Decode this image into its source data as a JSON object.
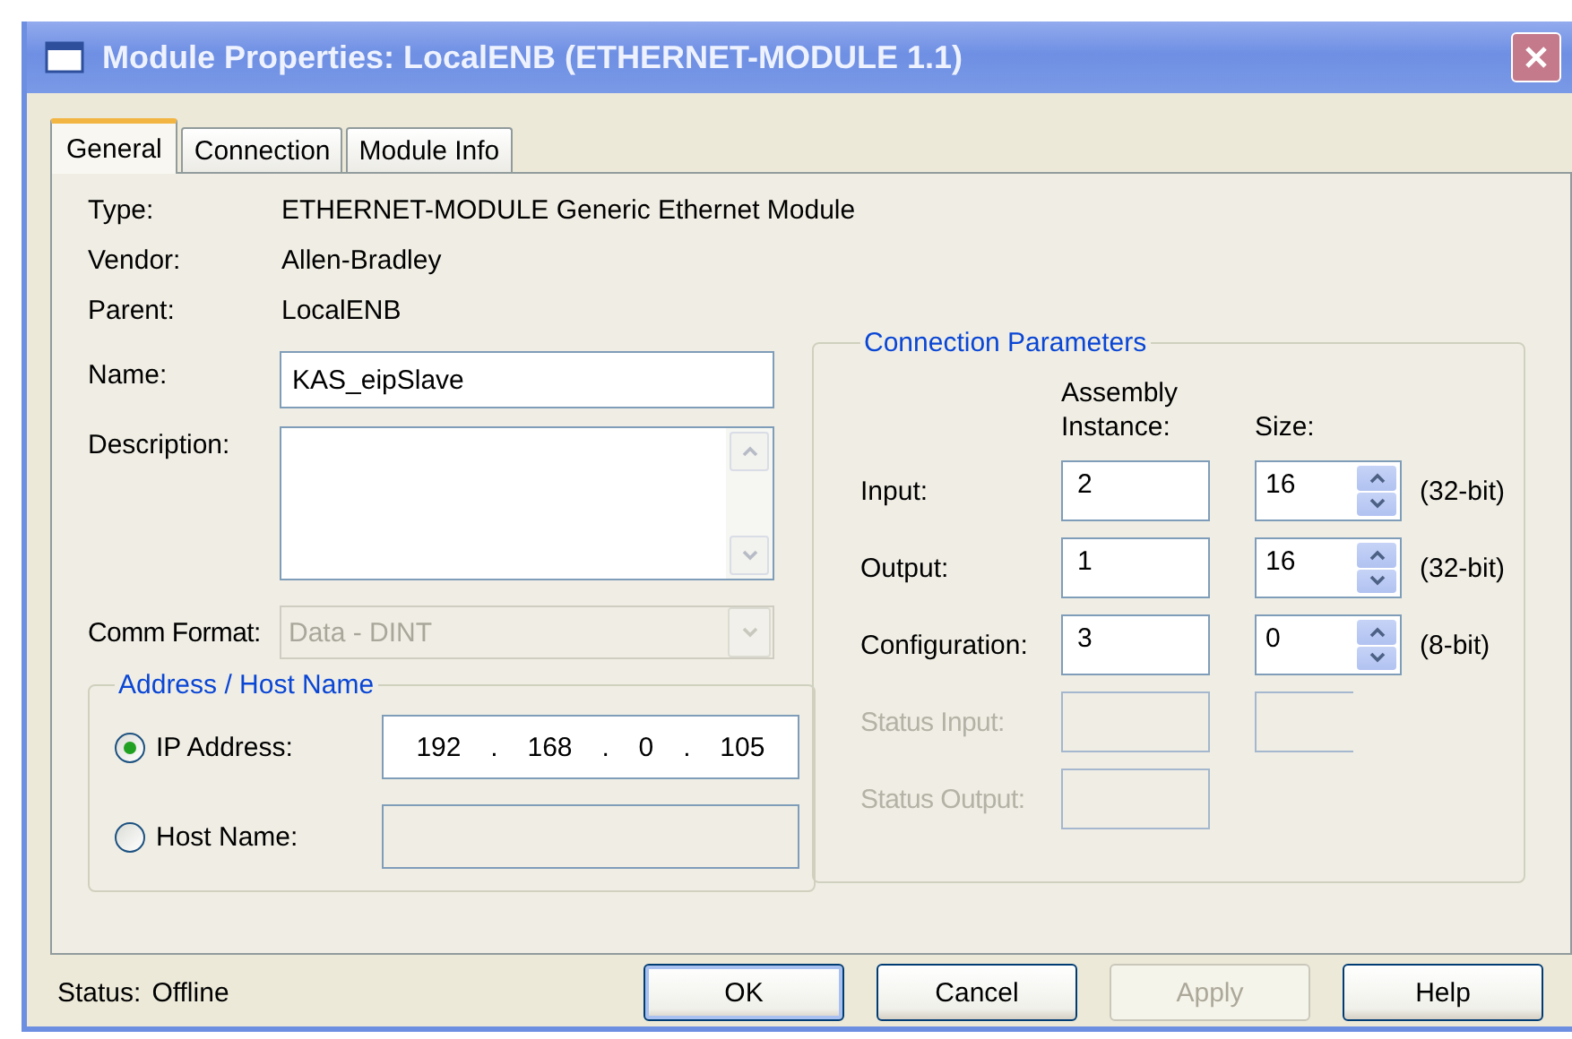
{
  "window": {
    "title": "Module Properties: LocalENB (ETHERNET-MODULE 1.1)"
  },
  "tabs": [
    {
      "label": "General",
      "selected": true
    },
    {
      "label": "Connection",
      "selected": false
    },
    {
      "label": "Module Info",
      "selected": false
    }
  ],
  "general": {
    "info": [
      {
        "label": "Type:",
        "value": "ETHERNET-MODULE Generic Ethernet Module"
      },
      {
        "label": "Vendor:",
        "value": "Allen-Bradley"
      },
      {
        "label": "Parent:",
        "value": "LocalENB"
      }
    ],
    "name": {
      "label": "Name:",
      "value": "KAS_eipSlave"
    },
    "description": {
      "label": "Description:"
    },
    "comm_format": {
      "label": "Comm Format:",
      "value": "Data - DINT",
      "disabled": true
    },
    "address": {
      "title": "Address / Host Name",
      "options": [
        {
          "label": "IP Address:",
          "selected": true,
          "kind": "ip",
          "octets": [
            "192",
            "168",
            "0",
            "105"
          ],
          "separator": "."
        },
        {
          "label": "Host Name:",
          "selected": false,
          "kind": "text"
        }
      ]
    }
  },
  "connection_parameters": {
    "title": "Connection Parameters",
    "instance_header": "Assembly Instance:",
    "size_header": "Size:",
    "rows": [
      {
        "label": "Input:",
        "instance": "2",
        "size": "16",
        "unit": "(32-bit)",
        "disabled": false,
        "kind": "spinner"
      },
      {
        "label": "Output:",
        "instance": "1",
        "size": "16",
        "unit": "(32-bit)",
        "disabled": false,
        "kind": "spinner"
      },
      {
        "label": "Configuration:",
        "instance": "3",
        "size": "0",
        "unit": "(8-bit)",
        "disabled": false,
        "kind": "spinner"
      },
      {
        "label": "Status Input:",
        "disabled": true,
        "kind": "box"
      },
      {
        "label": "Status Output:",
        "disabled": true,
        "kind": "none"
      }
    ]
  },
  "status": {
    "label": "Status:",
    "value": "Offline"
  },
  "buttons": [
    {
      "label": "OK",
      "default": true,
      "disabled": false
    },
    {
      "label": "Cancel",
      "default": false,
      "disabled": false
    },
    {
      "label": "Apply",
      "default": false,
      "disabled": true
    },
    {
      "label": "Help",
      "default": false,
      "disabled": false
    }
  ]
}
